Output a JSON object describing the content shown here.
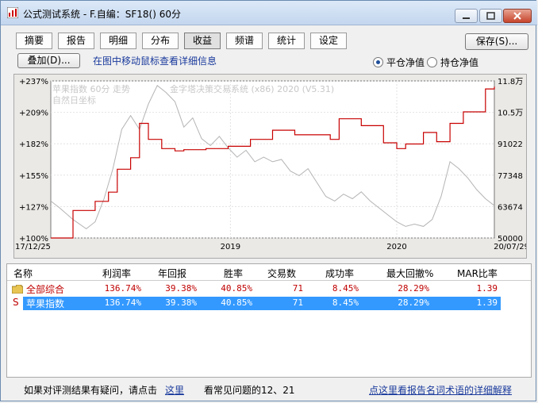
{
  "window": {
    "title": "公式测试系统 - F.自编：SF18() 60分"
  },
  "tabs": [
    {
      "label": "摘要",
      "active": false
    },
    {
      "label": "报告",
      "active": false
    },
    {
      "label": "明细",
      "active": false
    },
    {
      "label": "分布",
      "active": false
    },
    {
      "label": "收益",
      "active": true
    },
    {
      "label": "频谱",
      "active": false
    },
    {
      "label": "统计",
      "active": false
    },
    {
      "label": "设定",
      "active": false
    }
  ],
  "toolbar": {
    "save_label": "保存(S)...",
    "overlay_label": "叠加(D)...",
    "hint": "在图中移动鼠标查看详细信息",
    "radio_close": "平仓净值",
    "radio_hold": "持仓净值"
  },
  "chart_data": {
    "type": "line",
    "legend": [
      "苹果指数 60分 走势",
      "自然日坐标"
    ],
    "watermark": "金字塔决策交易系统 (x86) 2020 (V5.31)",
    "left_axis_ticks": [
      "+237%",
      "+209%",
      "+182%",
      "+155%",
      "+127%",
      "+100%"
    ],
    "right_axis_ticks": [
      "11.8万",
      "10.5万",
      "91022",
      "77348",
      "63674",
      "50000"
    ],
    "x_ticks": [
      "17/12/25",
      "2019",
      "2020",
      "20/07/29"
    ],
    "left_ylim": [
      100,
      237
    ],
    "right_ylim": [
      50000,
      118000
    ],
    "series": [
      {
        "name": "苹果指数 60分 走势",
        "color": "#b4b4b4",
        "x": [
          0.0,
          0.02,
          0.05,
          0.08,
          0.1,
          0.12,
          0.14,
          0.16,
          0.18,
          0.2,
          0.22,
          0.24,
          0.26,
          0.28,
          0.3,
          0.32,
          0.34,
          0.36,
          0.38,
          0.4,
          0.42,
          0.44,
          0.46,
          0.48,
          0.5,
          0.52,
          0.54,
          0.56,
          0.58,
          0.6,
          0.62,
          0.64,
          0.66,
          0.68,
          0.7,
          0.72,
          0.74,
          0.76,
          0.78,
          0.8,
          0.82,
          0.84,
          0.86,
          0.88,
          0.9,
          0.92,
          0.94,
          0.96,
          0.98,
          1.0
        ],
        "values": [
          66000,
          63000,
          58000,
          54000,
          57000,
          67000,
          80000,
          97000,
          103000,
          97000,
          108000,
          116000,
          113000,
          109000,
          98000,
          102000,
          93000,
          90000,
          94000,
          89000,
          85000,
          88000,
          83000,
          85000,
          83000,
          84000,
          79000,
          77000,
          80000,
          74000,
          68000,
          66000,
          69000,
          67000,
          70000,
          66000,
          63000,
          60000,
          57000,
          55000,
          56000,
          55000,
          58000,
          68000,
          83000,
          80000,
          76000,
          71000,
          67000,
          64000
        ]
      },
      {
        "name": "净值",
        "color": "#c80000",
        "x": [
          0.0,
          0.04,
          0.05,
          0.08,
          0.1,
          0.13,
          0.15,
          0.18,
          0.2,
          0.22,
          0.25,
          0.28,
          0.3,
          0.35,
          0.4,
          0.45,
          0.5,
          0.55,
          0.6,
          0.63,
          0.65,
          0.7,
          0.75,
          0.78,
          0.8,
          0.84,
          0.87,
          0.9,
          0.93,
          0.96,
          0.98,
          1.0
        ],
        "values": [
          100,
          100,
          124,
          124,
          132,
          140,
          160,
          170,
          200,
          186,
          178,
          176,
          177,
          178,
          180,
          186,
          194,
          190,
          190,
          186,
          204,
          198,
          183,
          178,
          182,
          192,
          184,
          200,
          210,
          210,
          230,
          232
        ]
      }
    ]
  },
  "table": {
    "columns": [
      "名称",
      "利润率",
      "年回报",
      "胜率",
      "交易数",
      "成功率",
      "最大回撤%",
      "MAR比率"
    ],
    "rows": [
      {
        "name": "全部综合",
        "icon": "folder-icon",
        "values": [
          "136.74%",
          "39.38%",
          "40.85%",
          "71",
          "8.45%",
          "28.29%",
          "1.39"
        ],
        "selected": false
      },
      {
        "name": "苹果指数",
        "icon": "S",
        "values": [
          "136.74%",
          "39.38%",
          "40.85%",
          "71",
          "8.45%",
          "28.29%",
          "1.39"
        ],
        "selected": true
      }
    ]
  },
  "footer": {
    "question": "如果对评测结果有疑问，请点击",
    "here_link": "这里",
    "faq": "看常见问题的12、21",
    "glossary_link": "点这里看报告名词术语的详细解释"
  }
}
